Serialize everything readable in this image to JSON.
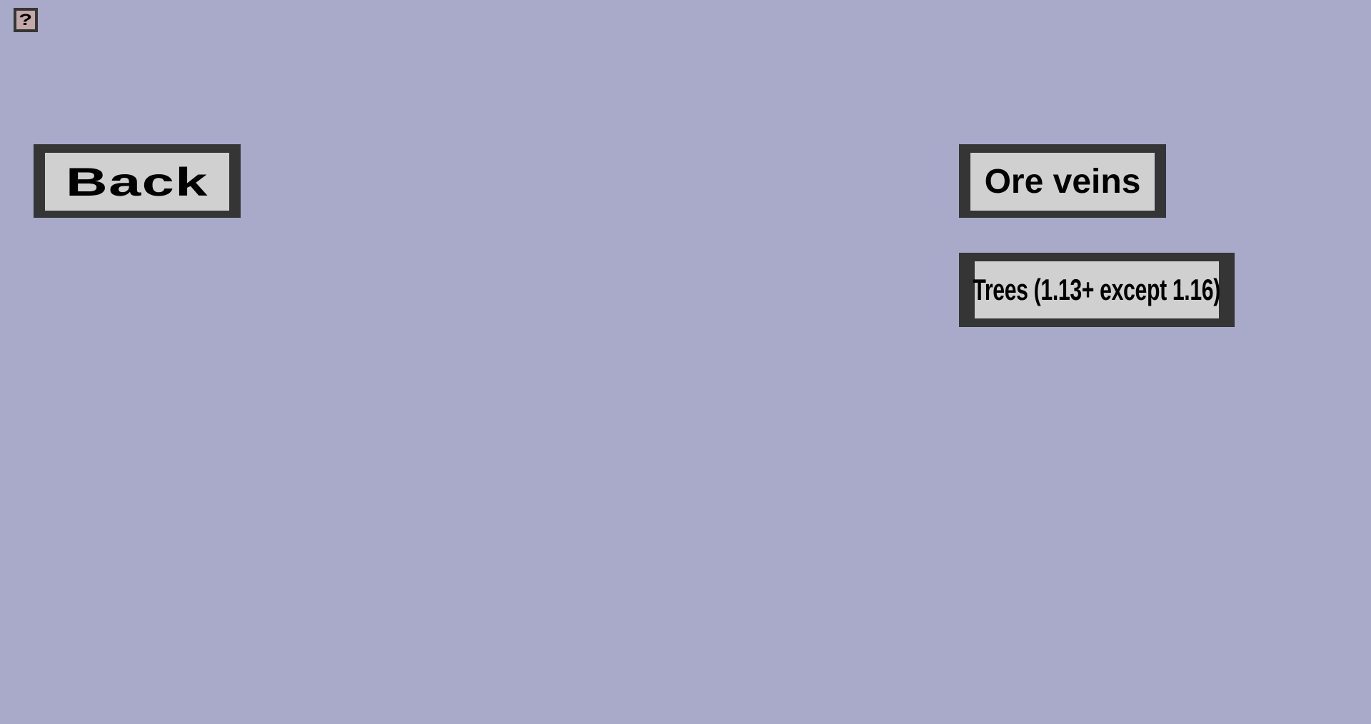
{
  "help_button": {
    "label": "?",
    "icon": "question-mark-icon"
  },
  "buttons": {
    "back": "Back",
    "ore_veins": "Ore veins",
    "trees": "Trees (1.13+ except 1.16)"
  },
  "colors": {
    "background": "#a9a9c9",
    "button_face": "#d0d0d0",
    "button_border": "#353535",
    "help_face": "#c4a8aa",
    "text": "#000000"
  }
}
